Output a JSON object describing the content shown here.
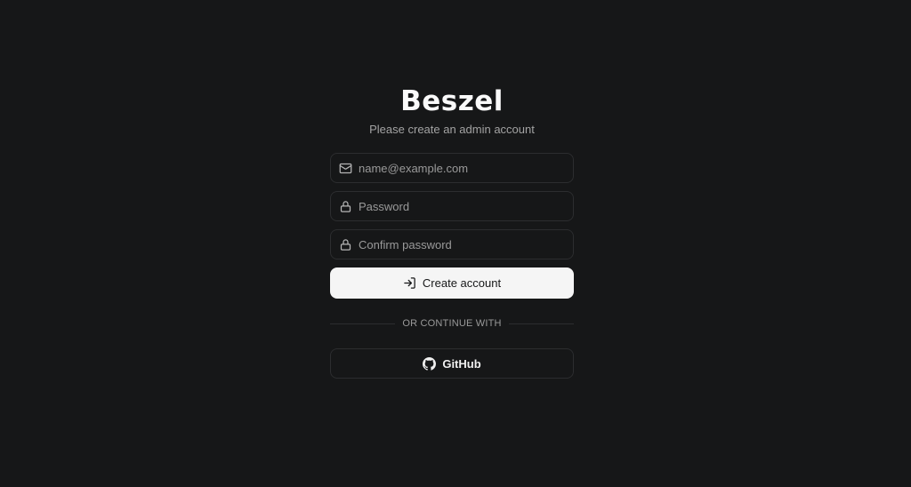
{
  "brand": {
    "title": "Beszel"
  },
  "subtitle": "Please create an admin account",
  "form": {
    "email": {
      "placeholder": "name@example.com",
      "value": "",
      "icon": "mail-icon"
    },
    "password": {
      "placeholder": "Password",
      "value": "",
      "icon": "lock-icon"
    },
    "confirm_password": {
      "placeholder": "Confirm password",
      "value": "",
      "icon": "lock-icon"
    },
    "submit": {
      "label": "Create account",
      "icon": "log-in-icon"
    }
  },
  "divider": {
    "text": "OR CONTINUE WITH"
  },
  "oauth": {
    "github": {
      "label": "GitHub",
      "icon": "github-icon"
    }
  },
  "colors": {
    "background": "#161718",
    "border": "#2c2d2f",
    "primary_button": "#f5f5f5",
    "muted_text": "#a3a3a3"
  }
}
